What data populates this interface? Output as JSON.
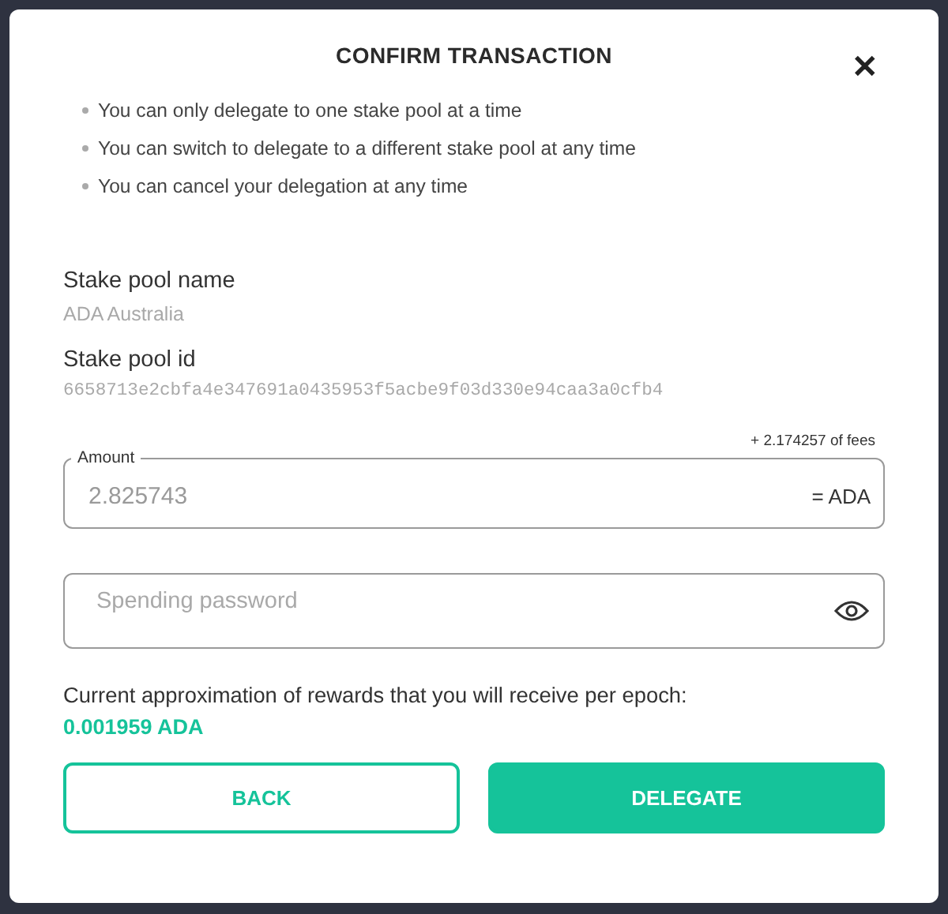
{
  "dialog": {
    "title": "CONFIRM TRANSACTION",
    "close": "✕",
    "notes": [
      "You can only delegate to one stake pool at a time",
      "You can switch to delegate to a different stake pool at any time",
      "You can cancel your delegation at any time"
    ],
    "fields": [
      {
        "kind": "info",
        "label": "Stake pool name",
        "value": "ADA Australia",
        "mono": false
      },
      {
        "kind": "info",
        "label": "Stake pool id",
        "value": "6658713e2cbfa4e347691a0435953f5acbe9f03d330e94caa3a0cfb4",
        "mono": true
      },
      {
        "kind": "amount",
        "label": "Amount",
        "fees": "+ 2.174257 of fees",
        "value": "2.825743",
        "suffix": "= ADA"
      },
      {
        "kind": "password",
        "placeholder": "Spending password"
      }
    ],
    "rewards": {
      "text": "Current approximation of rewards that you will receive per epoch:",
      "value": "0.001959 ADA"
    },
    "buttons": [
      {
        "label": "BACK",
        "kind": "secondary"
      },
      {
        "label": "DELEGATE",
        "kind": "primary"
      }
    ]
  }
}
